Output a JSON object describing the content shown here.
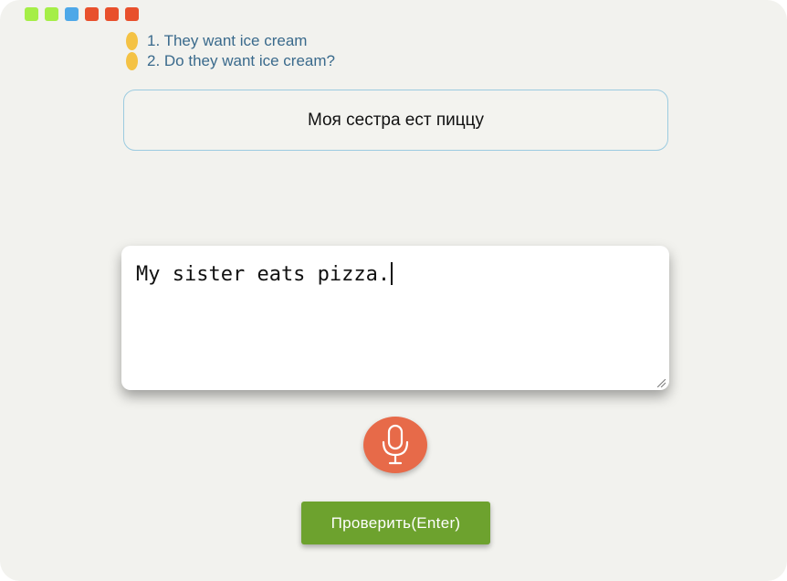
{
  "window_controls": [
    {
      "name": "control-dot-1",
      "color": "#a5ee47"
    },
    {
      "name": "control-dot-2",
      "color": "#a5ee47"
    },
    {
      "name": "control-dot-3",
      "color": "#4ea8e8"
    },
    {
      "name": "control-dot-4",
      "color": "#e8502c"
    },
    {
      "name": "control-dot-5",
      "color": "#e8502c"
    },
    {
      "name": "control-dot-6",
      "color": "#e8502c"
    }
  ],
  "history": {
    "marker_color": "#f4c244",
    "items": [
      {
        "text": "1. They want ice cream"
      },
      {
        "text": "2. Do they want ice cream?"
      }
    ]
  },
  "task": {
    "source_sentence": "Моя сестра ест пиццу"
  },
  "answer": {
    "value": "My sister eats pizza."
  },
  "mic": {
    "icon": "microphone-icon",
    "color": "#e76a49"
  },
  "check_button": {
    "label": "Проверить(Enter)",
    "color": "#6da22e"
  }
}
